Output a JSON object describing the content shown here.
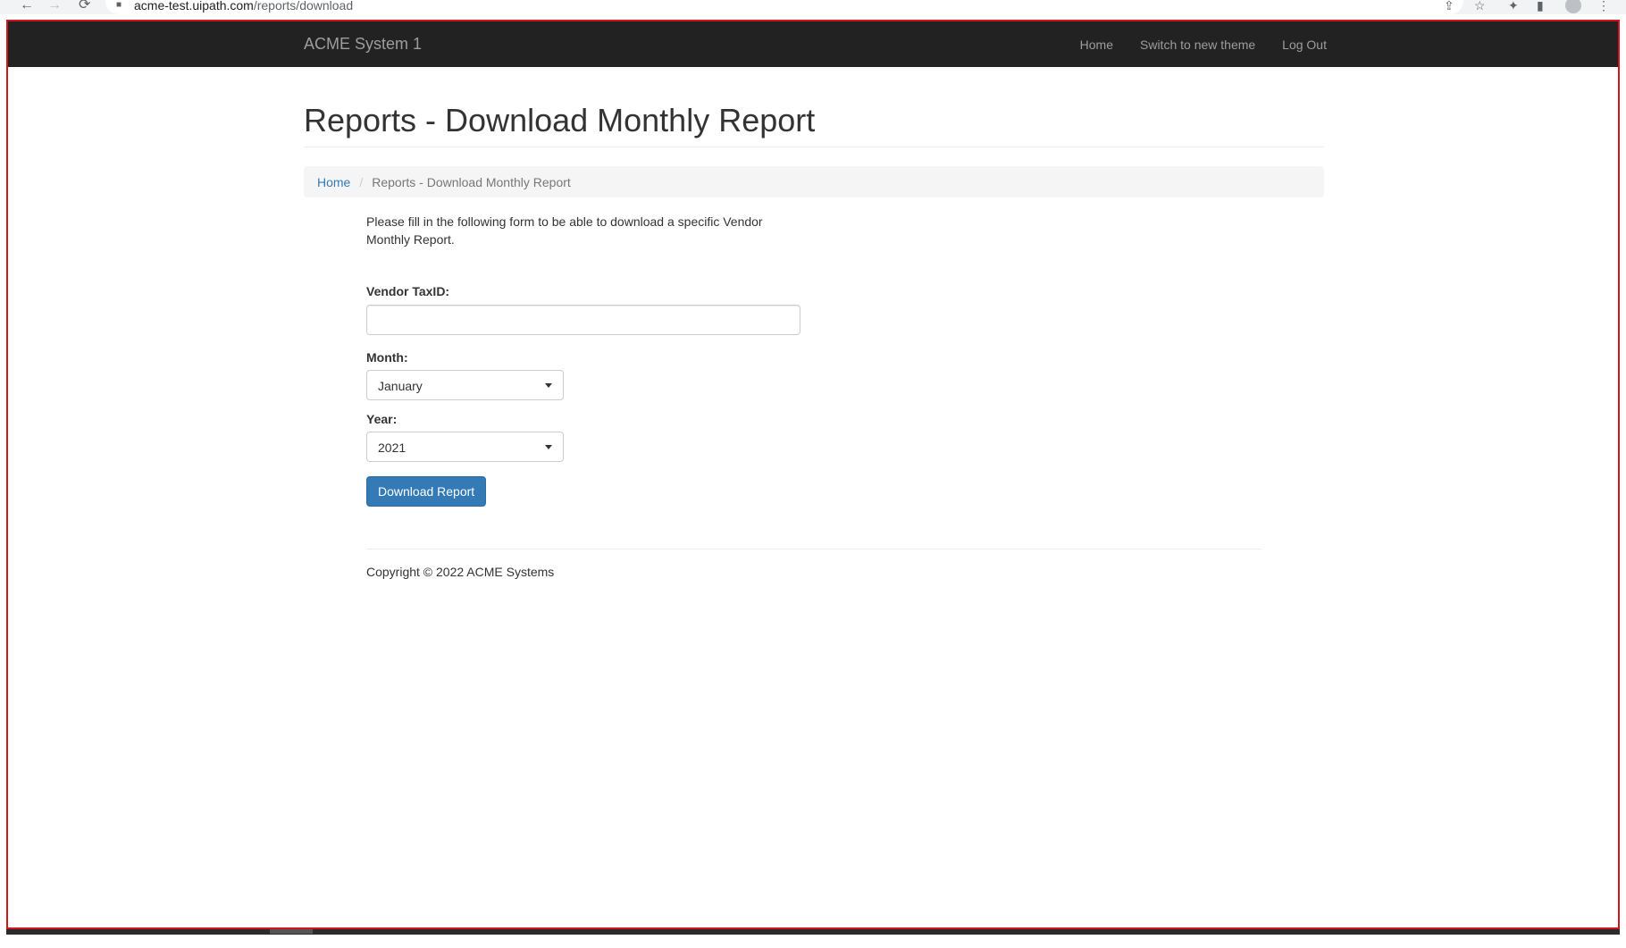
{
  "browser": {
    "url_host": "acme-test.uipath.com",
    "url_path": "/reports/download",
    "back_icon": "←",
    "forward_icon": "→",
    "reload_icon": "⟳",
    "lock_icon": "🔒",
    "share_icon": "⇪",
    "star_icon": "☆",
    "extensions_icon": "✦",
    "panel_icon": "▮",
    "menu_icon": "⋮"
  },
  "navbar": {
    "brand": "ACME System 1",
    "links": [
      "Home",
      "Switch to new theme",
      "Log Out"
    ]
  },
  "page": {
    "title": "Reports - Download Monthly Report"
  },
  "breadcrumb": {
    "home": "Home",
    "separator": "/",
    "current": "Reports - Download Monthly Report"
  },
  "form": {
    "intro": "Please fill in the following form to be able to download a specific Vendor Monthly Report.",
    "vendor_label": "Vendor TaxID:",
    "vendor_value": "",
    "month_label": "Month:",
    "month_value": "January",
    "year_label": "Year:",
    "year_value": "2021",
    "submit_label": "Download Report"
  },
  "footer": {
    "copyright": "Copyright © 2022 ACME Systems"
  },
  "colors": {
    "navbar_bg": "#222222",
    "nav_text": "#9d9d9d",
    "link": "#337ab7",
    "button_bg": "#337ab7",
    "frame_border": "#d0151c"
  }
}
